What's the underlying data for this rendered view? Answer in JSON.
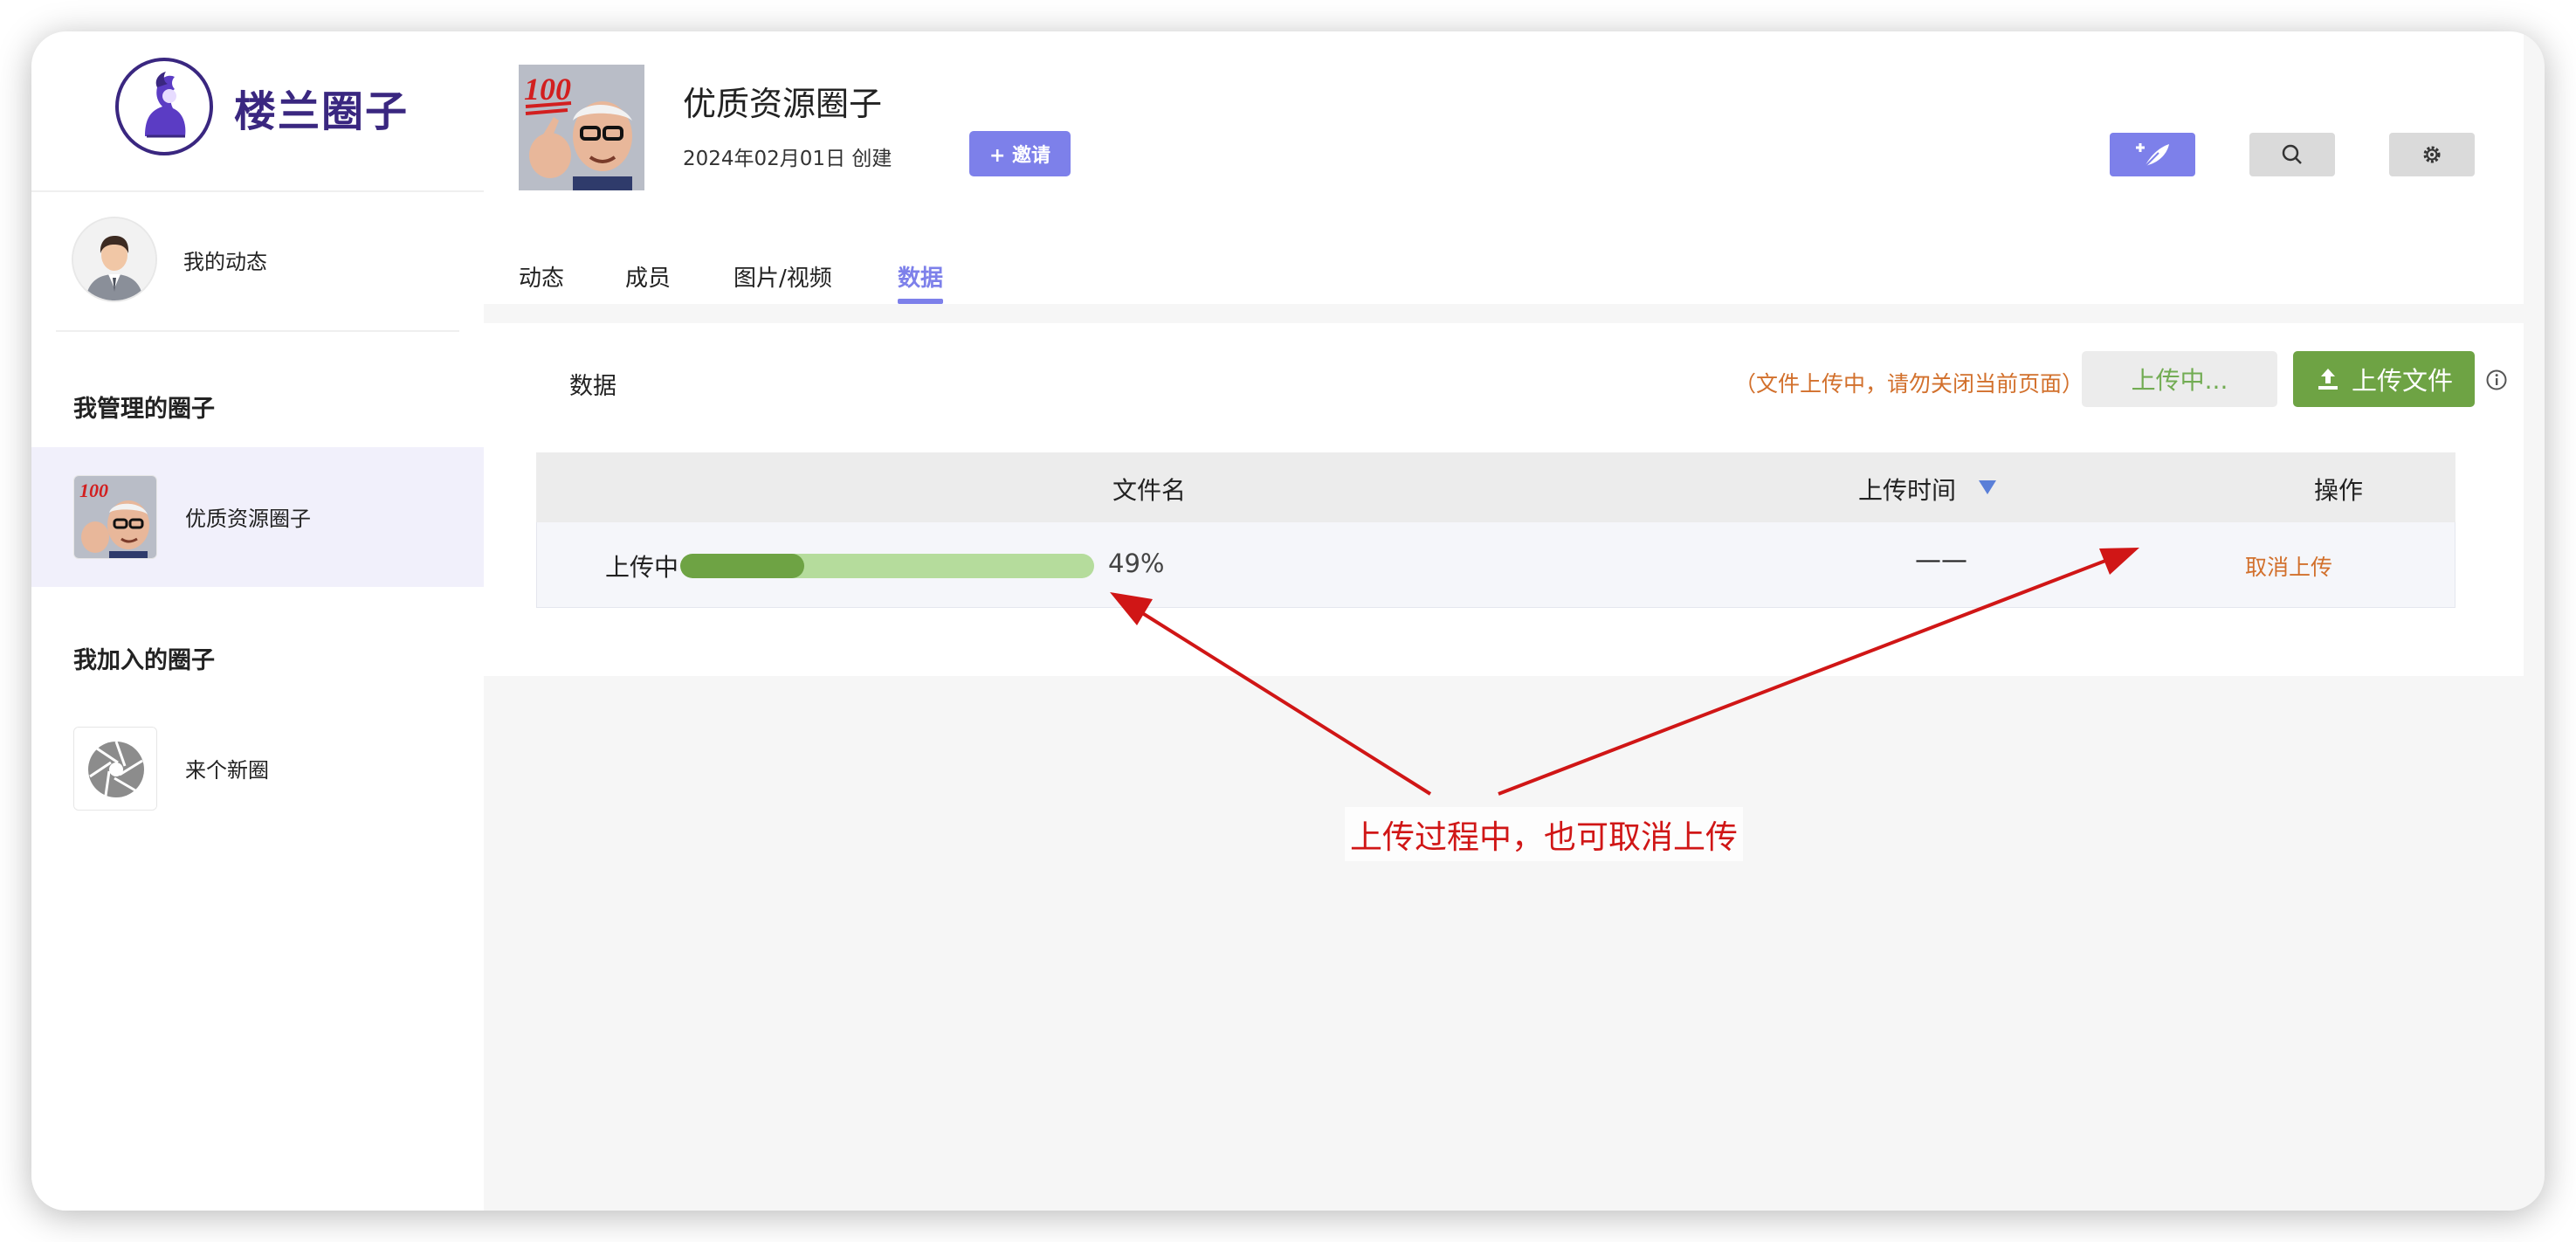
{
  "sidebar": {
    "brand_name": "楼兰圈子",
    "my_feed_label": "我的动态",
    "managed_title": "我管理的圈子",
    "managed_circles": [
      {
        "label": "优质资源圈子"
      }
    ],
    "joined_title": "我加入的圈子",
    "joined_circles": [
      {
        "label": "来个新圈"
      }
    ]
  },
  "header": {
    "group_title": "优质资源圈子",
    "created_date": "2024年02月01日 创建",
    "invite_label": "+ 邀请",
    "cover_badge": "100",
    "tabs": [
      {
        "label": "动态"
      },
      {
        "label": "成员"
      },
      {
        "label": "图片/视频"
      },
      {
        "label": "数据",
        "active": true
      }
    ],
    "icons": [
      "feather-icon",
      "search-icon",
      "gear-icon"
    ]
  },
  "panel": {
    "title": "数据",
    "warning": "（文件上传中，请勿关闭当前页面）",
    "uploading_label": "上传中...",
    "upload_label": "上传文件",
    "columns": {
      "filename": "文件名",
      "upload_time": "上传时间",
      "actions": "操作"
    },
    "rows": [
      {
        "status": "上传中",
        "progress": 0.3,
        "progress_text": "49%",
        "upload_time": "——",
        "action": "取消上传"
      }
    ]
  },
  "annotation": {
    "text": "上传过程中，也可取消上传",
    "color": "#d01616"
  },
  "colors": {
    "accent": "#7d80ea",
    "brand": "#3a2780",
    "upload_green": "#6ea344",
    "progress_track": "#b5dc9c",
    "warning_orange": "#d2702c"
  }
}
